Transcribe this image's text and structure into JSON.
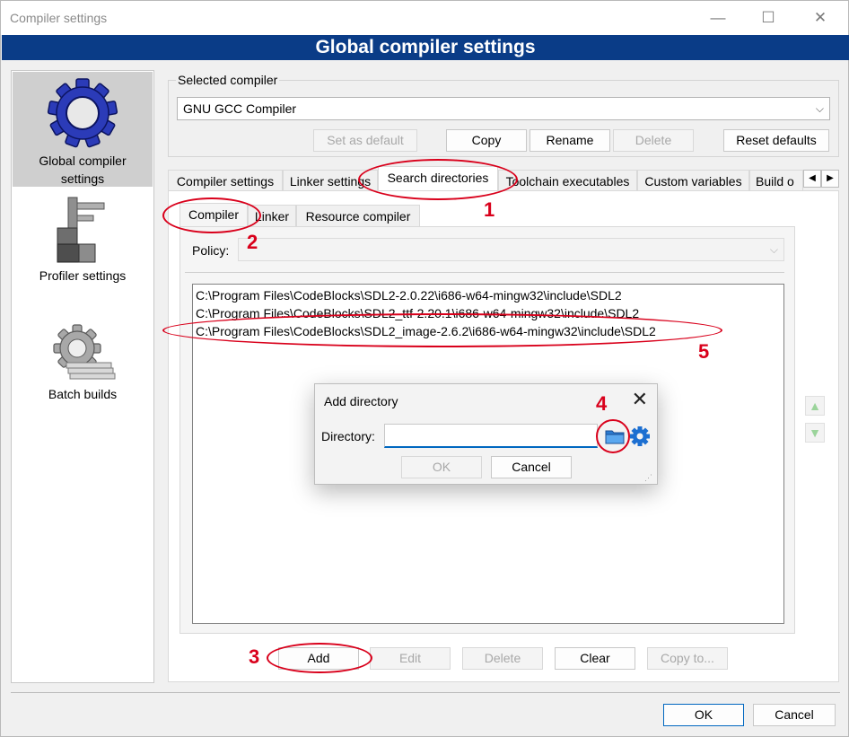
{
  "window": {
    "title": "Compiler settings",
    "minimize": "—",
    "maximize": "☐",
    "close": "✕"
  },
  "banner": {
    "title": "Global compiler settings"
  },
  "sidebar": {
    "items": [
      {
        "label_line1": "Global compiler",
        "label_line2": "settings"
      },
      {
        "label_line1": "Profiler settings"
      },
      {
        "label_line1": "Batch builds"
      }
    ]
  },
  "selected_compiler": {
    "group_label": "Selected compiler",
    "value": "GNU GCC Compiler",
    "buttons": {
      "set_default": "Set as default",
      "copy": "Copy",
      "rename": "Rename",
      "delete": "Delete",
      "reset_defaults": "Reset defaults"
    }
  },
  "tabs": {
    "items": [
      "Compiler settings",
      "Linker settings",
      "Search directories",
      "Toolchain executables",
      "Custom variables",
      "Build o"
    ],
    "scroll_left": "◀",
    "scroll_right": "▶"
  },
  "subtabs": {
    "items": [
      "Compiler",
      "Linker",
      "Resource compiler"
    ]
  },
  "policy": {
    "label": "Policy:",
    "value": ""
  },
  "directories": [
    "C:\\Program Files\\CodeBlocks\\SDL2-2.0.22\\i686-w64-mingw32\\include\\SDL2",
    "C:\\Program Files\\CodeBlocks\\SDL2_ttf-2.20.1\\i686-w64-mingw32\\include\\SDL2",
    "C:\\Program Files\\CodeBlocks\\SDL2_image-2.6.2\\i686-w64-mingw32\\include\\SDL2"
  ],
  "list_buttons": {
    "add": "Add",
    "edit": "Edit",
    "delete": "Delete",
    "clear": "Clear",
    "copy_to": "Copy to..."
  },
  "dialog": {
    "title": "Add directory",
    "close": "✕",
    "label": "Directory:",
    "value": "",
    "ok": "OK",
    "cancel": "Cancel"
  },
  "footer": {
    "ok": "OK",
    "cancel": "Cancel"
  },
  "annotations": [
    "1",
    "2",
    "3",
    "4",
    "5"
  ],
  "colors": {
    "banner": "#0a3c87",
    "annotation": "#d9001b",
    "accent": "#0067c0"
  }
}
